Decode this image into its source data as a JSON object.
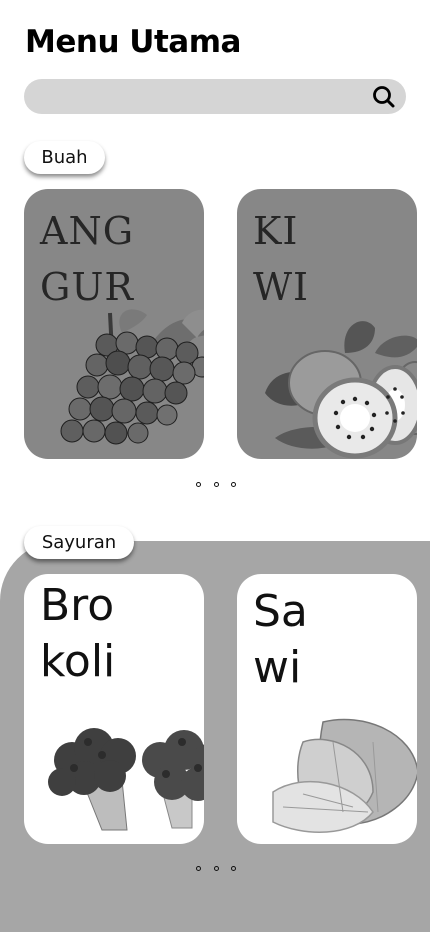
{
  "header": {
    "title": "Menu Utama"
  },
  "search": {
    "placeholder": "",
    "value": "",
    "icon": "search-icon"
  },
  "sections": [
    {
      "label": "Buah",
      "items": [
        {
          "name": "ANGGUR",
          "line1": "ANG",
          "line2": "GUR",
          "image": "grapes-illustration"
        },
        {
          "name": "KIWI",
          "line1": "KI",
          "line2": "WI",
          "image": "kiwi-illustration"
        }
      ],
      "pager_icon": "more-dots-icon"
    },
    {
      "label": "Sayuran",
      "items": [
        {
          "name": "Brokoli",
          "line1": "Bro",
          "line2": "koli",
          "image": "broccoli-illustration"
        },
        {
          "name": "Sawi",
          "line1": "Sa",
          "line2": "wi",
          "image": "chinese-cabbage-illustration"
        }
      ],
      "pager_icon": "more-dots-icon"
    }
  ],
  "colors": {
    "search_bg": "#d5d5d5",
    "fruit_card_bg": "#878787",
    "veg_section_bg": "#a6a6a6",
    "veg_card_bg": "#ffffff"
  }
}
